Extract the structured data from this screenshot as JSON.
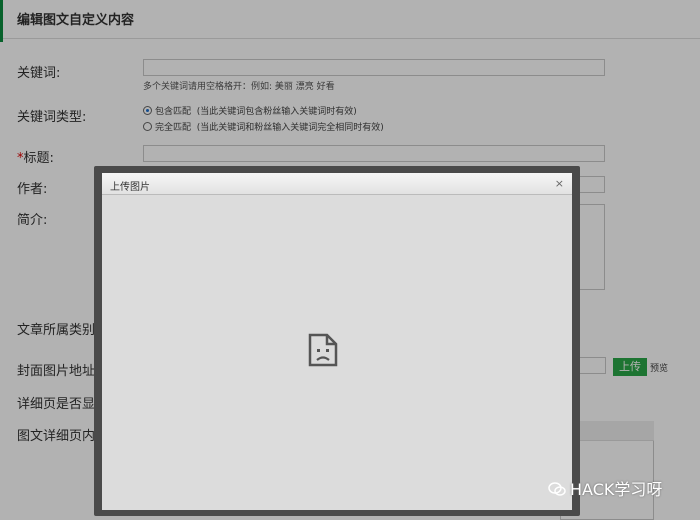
{
  "header": {
    "title": "编辑图文自定义内容"
  },
  "form": {
    "keyword_label": "关键词:",
    "keyword_value": "",
    "keyword_hint": "多个关键词请用空格格开：例如: 美丽 漂亮 好看",
    "keyword_type_label": "关键词类型:",
    "radio_contains_label": "包含匹配",
    "radio_contains_hint": "(当此关键词包含粉丝输入关键词时有效)",
    "radio_exact_label": "完全匹配",
    "radio_exact_hint": "(当此关键词和粉丝输入关键词完全相同时有效)",
    "title_required_mark": "*",
    "title_label": "标题:",
    "author_label": "作者:",
    "intro_label": "简介:",
    "category_label": "文章所属类别:",
    "cover_label": "封面图片地址:",
    "detail_show_label": "详细页是否显示",
    "detail_content_label": "图文详细页内容",
    "upload_button": "上传",
    "preview_link": "预览"
  },
  "dialog": {
    "title": "上传图片",
    "close": "×",
    "content_icon": "broken-page-icon"
  },
  "watermark": {
    "text": "HACK学习呀"
  },
  "colors": {
    "accent": "#0b8b3e",
    "button": "#2aa748",
    "radio_selected": "#1a6fd0"
  }
}
